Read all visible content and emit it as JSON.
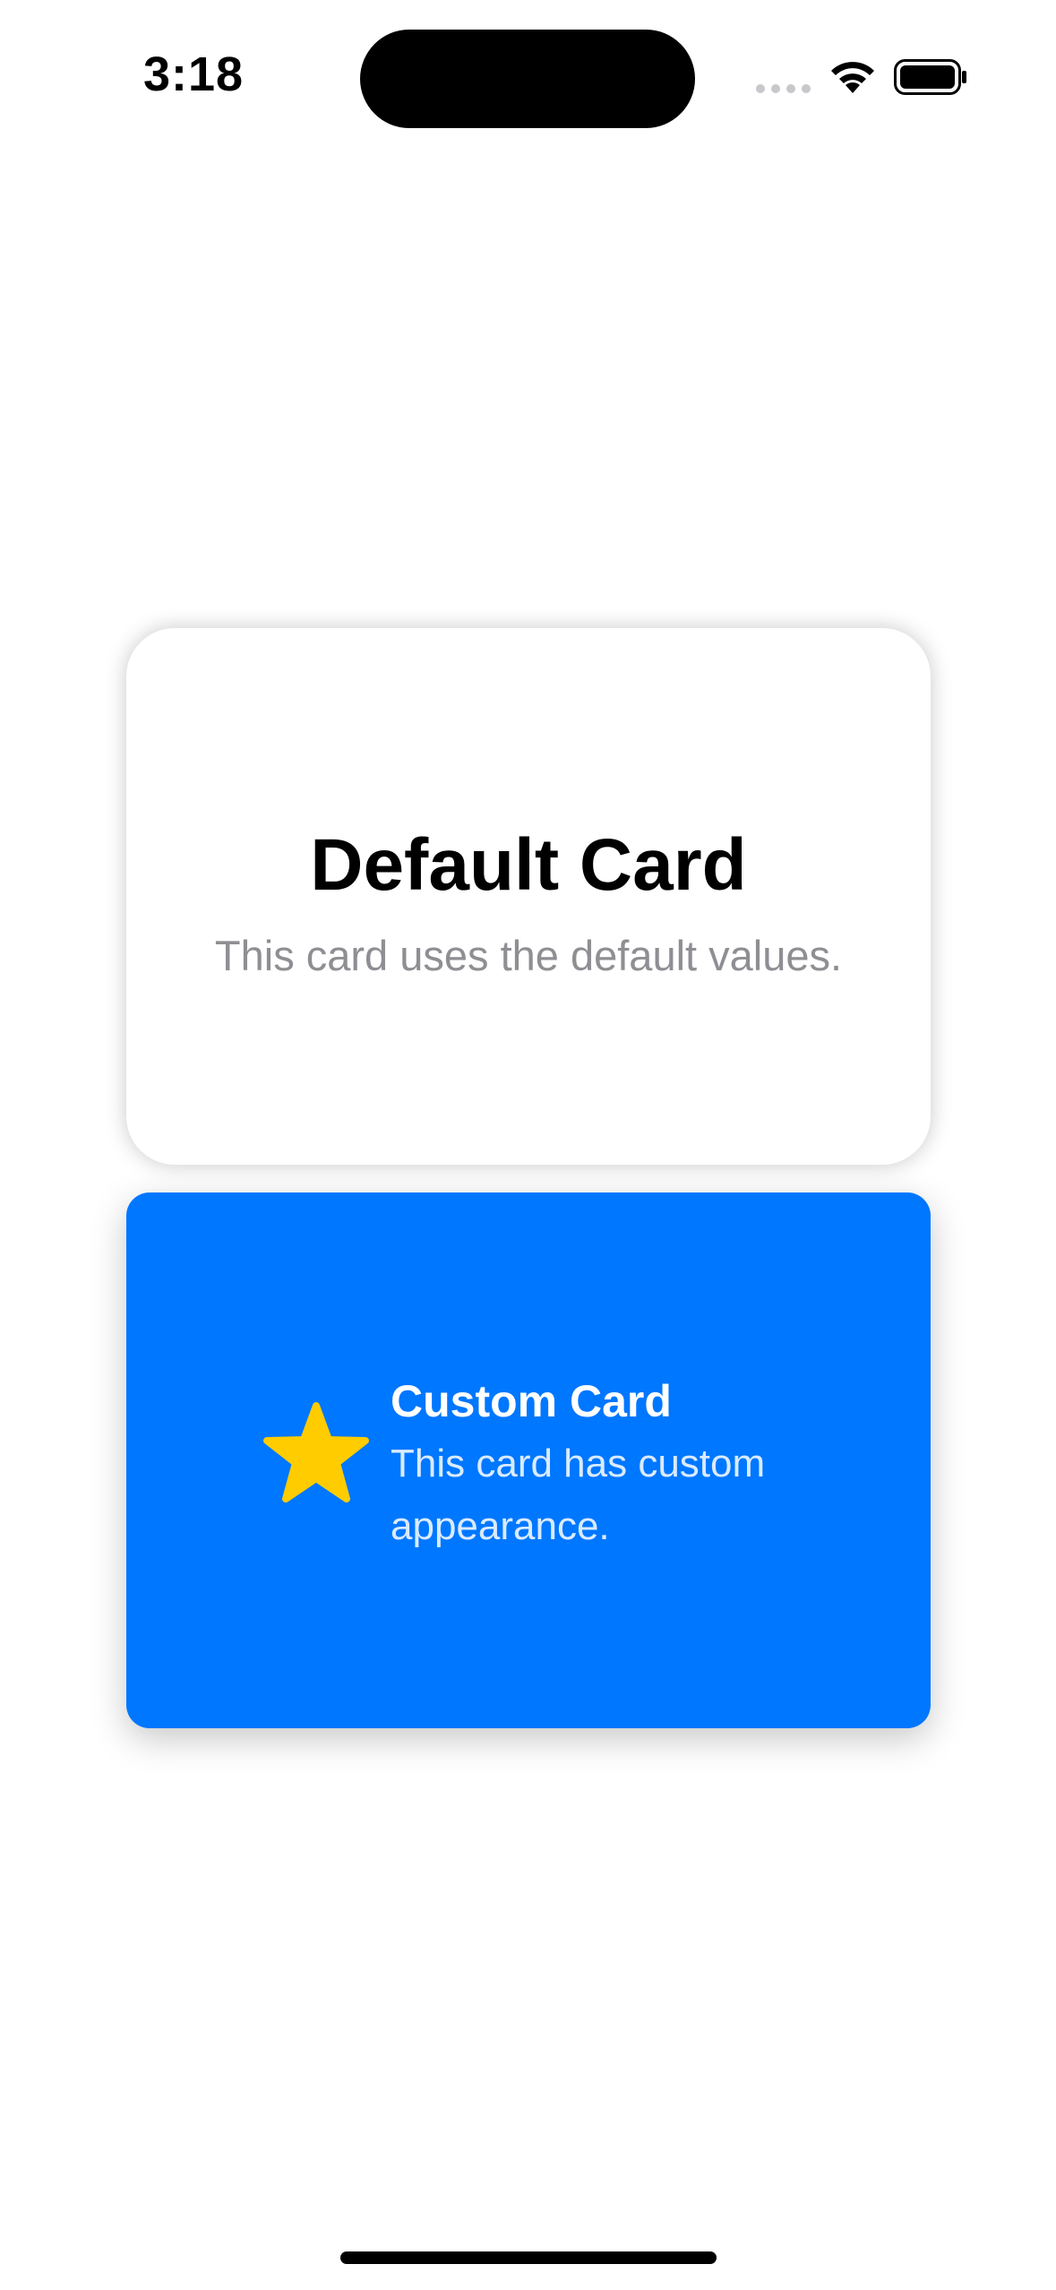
{
  "status_bar": {
    "time": "3:18"
  },
  "cards": {
    "default": {
      "title": "Default Card",
      "subtitle": "This card uses the default values."
    },
    "custom": {
      "title": "Custom Card",
      "subtitle": "This card has custom appearance.",
      "icon": "star-icon"
    }
  },
  "colors": {
    "accent_blue": "#0077ff",
    "star_yellow": "#ffcc00",
    "secondary_text": "#8e8e93"
  }
}
